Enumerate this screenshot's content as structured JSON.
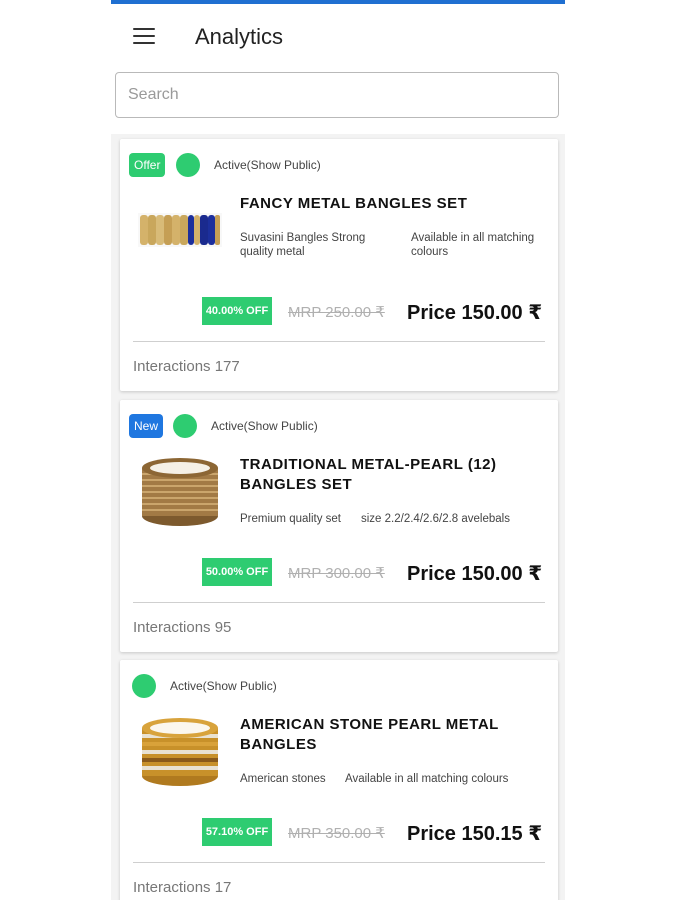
{
  "app": {
    "title": "Analytics"
  },
  "search": {
    "placeholder": "Search",
    "value": ""
  },
  "colors": {
    "accent": "#1f6fd1",
    "active_green": "#2ecc71",
    "new_blue": "#1f77e0"
  },
  "products": [
    {
      "badge": "Offer",
      "status": "Active(Show Public)",
      "title": "FANCY METAL BANGLES SET",
      "desc1": "Suvasini Bangles Strong quality metal",
      "desc2": "Available in all matching colours",
      "discount": "40.00% OFF",
      "mrp": "MRP 250.00 ₹",
      "price": "Price 150.00 ₹",
      "interactions_label": "Interactions",
      "interactions": "177",
      "image": "blue-gold-bangles-image"
    },
    {
      "badge": "New",
      "status": "Active(Show Public)",
      "title": "TRADITIONAL METAL-PEARL (12) BANGLES SET",
      "desc1": "Premium quality set",
      "desc2": "size 2.2/2.4/2.6/2.8 avelebals",
      "discount": "50.00% OFF",
      "mrp": "MRP 300.00 ₹",
      "price": "Price 150.00 ₹",
      "interactions_label": "Interactions",
      "interactions": "95",
      "image": "pearl-bangles-image"
    },
    {
      "badge": "",
      "status": "Active(Show Public)",
      "title": "AMERICAN STONE PEARL METAL BANGLES",
      "desc1": "American stones",
      "desc2": "Available in all matching colours",
      "discount": "57.10% OFF",
      "mrp": "MRP 350.00 ₹",
      "price": "Price 150.15 ₹",
      "interactions_label": "Interactions",
      "interactions": "17",
      "image": "stone-bangles-image"
    }
  ]
}
